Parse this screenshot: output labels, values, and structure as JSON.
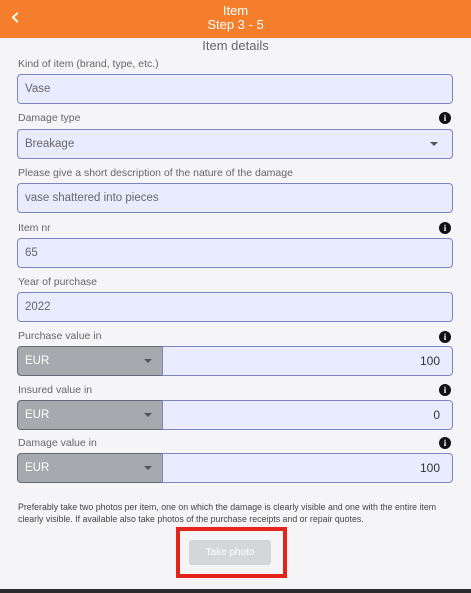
{
  "header": {
    "back_icon": "chevron-left-icon",
    "title": "Item",
    "step": "Step 3 - 5",
    "color": "#f47e2c"
  },
  "section_title": "Item details",
  "fields": {
    "kind": {
      "label": "Kind of item (brand, type, etc.)",
      "value": "Vase"
    },
    "damage_type": {
      "label": "Damage type",
      "value": "Breakage",
      "info_icon": "info-icon"
    },
    "description": {
      "label": "Please give a short description of the nature of the damage",
      "value": "vase shattered into pieces"
    },
    "item_nr": {
      "label": "Item nr",
      "value": "65",
      "info_icon": "info-icon"
    },
    "year": {
      "label": "Year of purchase",
      "value": "2022"
    },
    "purchase_value": {
      "label": "Purchase value in",
      "currency": "EUR",
      "amount": "100",
      "info_icon": "info-icon"
    },
    "insured_value": {
      "label": "Insured value in",
      "currency": "EUR",
      "amount": "0",
      "info_icon": "info-icon"
    },
    "damage_value": {
      "label": "Damage value in",
      "currency": "EUR",
      "amount": "100",
      "info_icon": "info-icon"
    }
  },
  "note": "Preferably take two photos per item, one on which the damage is clearly visible and one with the entire item clearly visible. If available also take photos of the purchase receipts and or repair quotes.",
  "photo_button": {
    "label": "Take photo"
  },
  "colors": {
    "input_bg": "#e9ecff",
    "input_border": "#7c84c2",
    "highlight": "#e4231b",
    "currency_bg": "#a7a9ae"
  }
}
